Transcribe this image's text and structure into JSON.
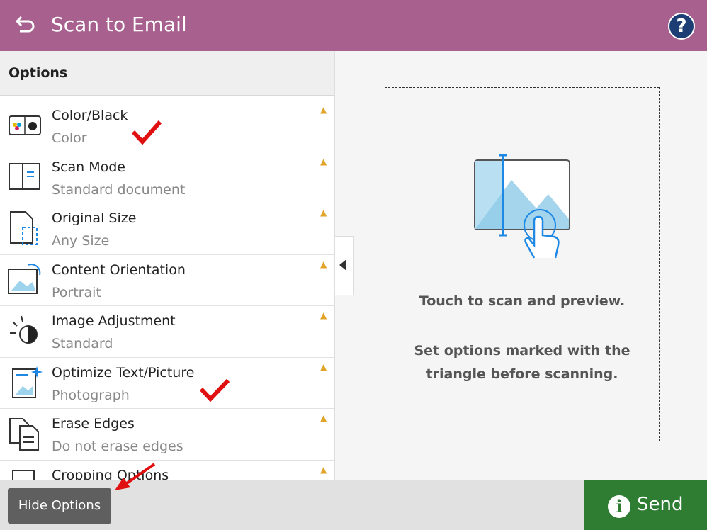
{
  "header": {
    "title": "Scan to Email",
    "help_label": "?",
    "accent_color": "#a8618f"
  },
  "panel": {
    "title": "Options",
    "options": [
      {
        "label": "Color/Black",
        "value": "Color",
        "icon": "color-black-icon"
      },
      {
        "label": "Scan Mode",
        "value": "Standard document",
        "icon": "scan-mode-icon"
      },
      {
        "label": "Original Size",
        "value": "Any Size",
        "icon": "original-size-icon"
      },
      {
        "label": "Content Orientation",
        "value": "Portrait",
        "icon": "orientation-icon"
      },
      {
        "label": "Image Adjustment",
        "value": "Standard",
        "icon": "image-adjustment-icon"
      },
      {
        "label": "Optimize Text/Picture",
        "value": "Photograph",
        "icon": "optimize-icon"
      },
      {
        "label": "Erase Edges",
        "value": "Do not erase edges",
        "icon": "erase-edges-icon"
      },
      {
        "label": "Cropping Options",
        "value": "",
        "icon": "cropping-icon"
      }
    ],
    "warning_glyph": "▲"
  },
  "preview": {
    "text1": "Touch to scan and preview.",
    "text2": "Set options marked with the triangle before scanning."
  },
  "footer": {
    "hide_label": "Hide Options",
    "send_label": "Send",
    "send_color": "#2e7d32"
  }
}
